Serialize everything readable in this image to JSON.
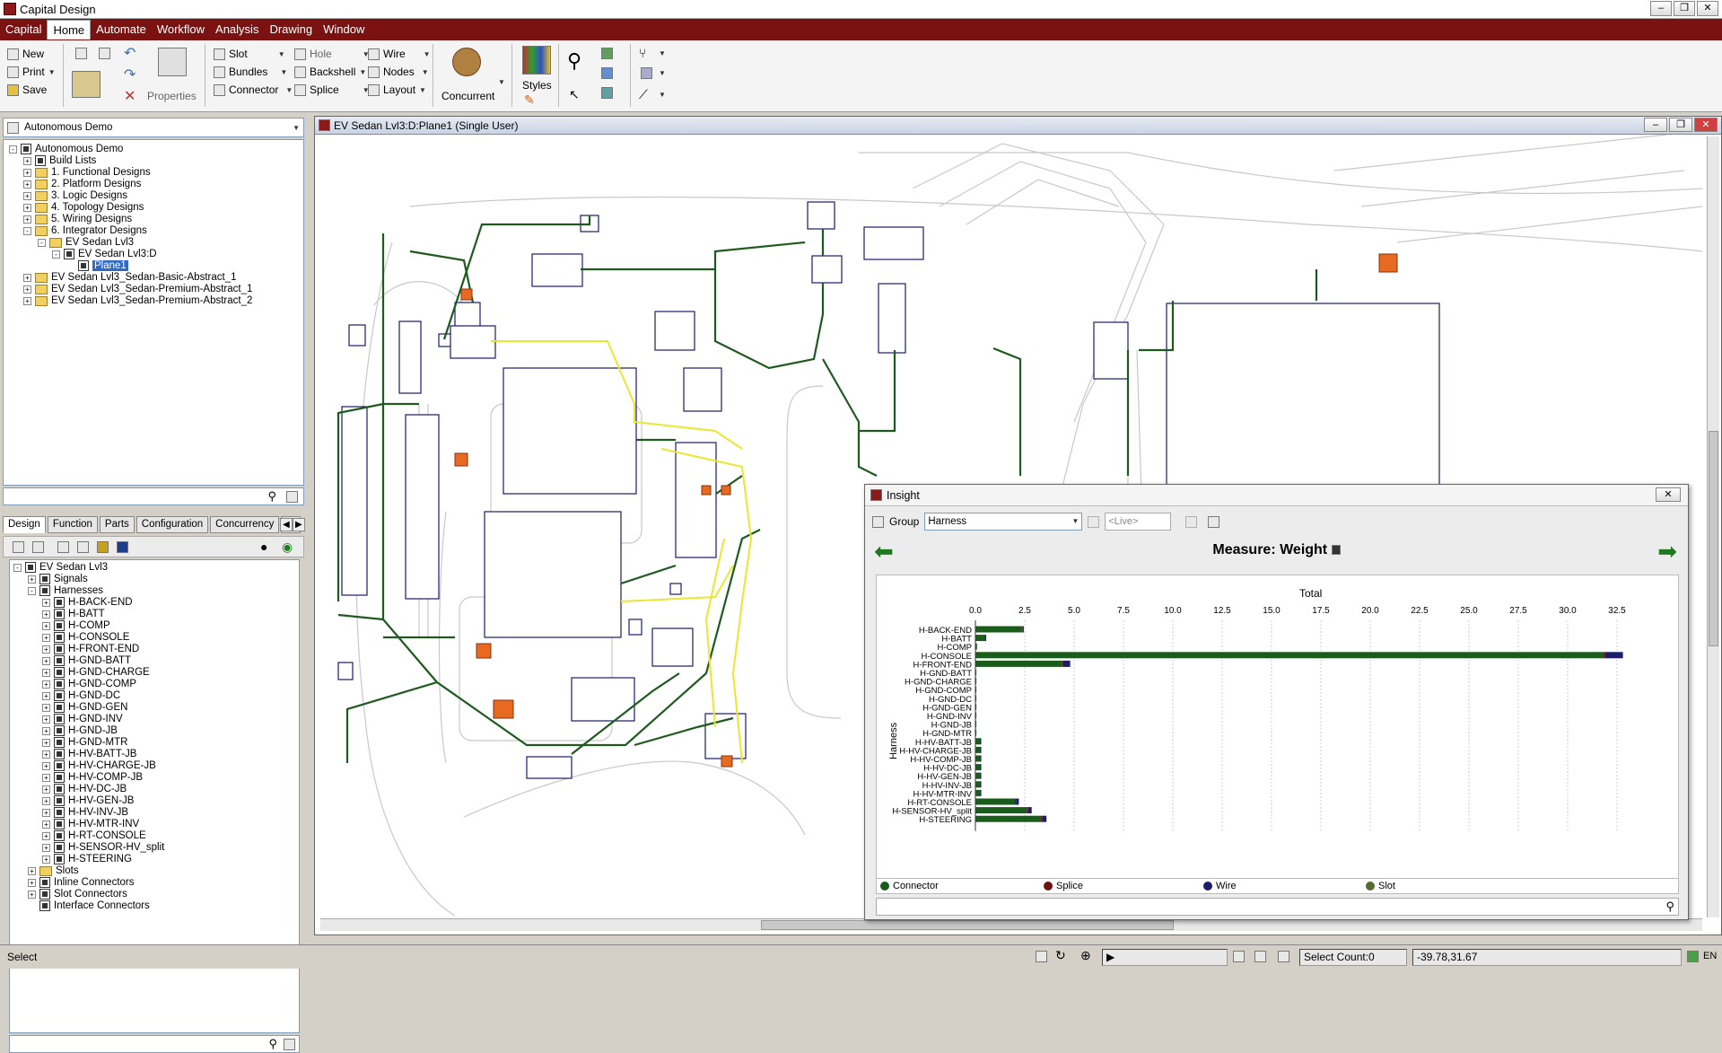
{
  "app": {
    "title": "Capital Design",
    "brand_color": "#7a1212"
  },
  "menu": [
    "Capital",
    "Home",
    "Automate",
    "Workflow",
    "Analysis",
    "Drawing",
    "Window"
  ],
  "ribbon": {
    "file": [
      "New",
      "Print",
      "Save"
    ],
    "properties": "Properties",
    "col1": [
      "Slot",
      "Bundles",
      "Connector"
    ],
    "col2": [
      "Hole",
      "Backshell",
      "Splice"
    ],
    "col3": [
      "Wire",
      "Nodes",
      "Layout"
    ],
    "concurrent": "Concurrent",
    "styles": "Styles"
  },
  "project": {
    "selector": "Autonomous Demo",
    "tree": [
      {
        "label": "Autonomous Demo",
        "level": 0,
        "exp": "-",
        "icon": "project"
      },
      {
        "label": "Build Lists",
        "level": 1,
        "exp": "+",
        "icon": "list"
      },
      {
        "label": "1. Functional Designs",
        "level": 1,
        "exp": "+",
        "icon": "folder"
      },
      {
        "label": "2. Platform Designs",
        "level": 1,
        "exp": "+",
        "icon": "folder"
      },
      {
        "label": "3. Logic Designs",
        "level": 1,
        "exp": "+",
        "icon": "folder"
      },
      {
        "label": "4. Topology Designs",
        "level": 1,
        "exp": "+",
        "icon": "folder"
      },
      {
        "label": "5. Wiring Designs",
        "level": 1,
        "exp": "+",
        "icon": "folder"
      },
      {
        "label": "6. Integrator Designs",
        "level": 1,
        "exp": "-",
        "icon": "folder"
      },
      {
        "label": "EV Sedan Lvl3",
        "level": 2,
        "exp": "-",
        "icon": "folder"
      },
      {
        "label": "EV Sedan Lvl3:D",
        "level": 3,
        "exp": "-",
        "icon": "design"
      },
      {
        "label": "Plane1",
        "level": 4,
        "exp": "",
        "icon": "design",
        "selected": true
      },
      {
        "label": "EV Sedan Lvl3_Sedan-Basic-Abstract_1",
        "level": 1,
        "exp": "+",
        "icon": "folder"
      },
      {
        "label": "EV Sedan Lvl3_Sedan-Premium-Abstract_1",
        "level": 1,
        "exp": "+",
        "icon": "folder"
      },
      {
        "label": "EV Sedan Lvl3_Sedan-Premium-Abstract_2",
        "level": 1,
        "exp": "+",
        "icon": "folder"
      }
    ]
  },
  "design_tabs": [
    "Design",
    "Function",
    "Parts",
    "Configuration",
    "Concurrency",
    "..."
  ],
  "design_tree": {
    "root": "EV Sedan Lvl3",
    "signals": "Signals",
    "harnesses": "Harnesses",
    "harness_items": [
      "H-BACK-END",
      "H-BATT",
      "H-COMP",
      "H-CONSOLE",
      "H-FRONT-END",
      "H-GND-BATT",
      "H-GND-CHARGE",
      "H-GND-COMP",
      "H-GND-DC",
      "H-GND-GEN",
      "H-GND-INV",
      "H-GND-JB",
      "H-GND-MTR",
      "H-HV-BATT-JB",
      "H-HV-CHARGE-JB",
      "H-HV-COMP-JB",
      "H-HV-DC-JB",
      "H-HV-GEN-JB",
      "H-HV-INV-JB",
      "H-HV-MTR-INV",
      "H-RT-CONSOLE",
      "H-SENSOR-HV_split",
      "H-STEERING"
    ],
    "others": [
      "Slots",
      "Inline Connectors",
      "Slot Connectors",
      "Interface Connectors"
    ]
  },
  "canvas": {
    "title": "EV Sedan Lvl3:D:Plane1 (Single User)"
  },
  "insight": {
    "title": "Insight",
    "group_label": "Group",
    "group_value": "Harness",
    "live_placeholder": "<Live>",
    "measure": "Measure: Weight",
    "column_title": "Total",
    "y_label": "Harness",
    "legend": [
      {
        "label": "Connector",
        "color": "#1a5c1a"
      },
      {
        "label": "Splice",
        "color": "#6b1414"
      },
      {
        "label": "Wire",
        "color": "#1c1c6a"
      },
      {
        "label": "Slot",
        "color": "#556b2f"
      }
    ]
  },
  "chart_data": {
    "type": "bar",
    "orientation": "horizontal",
    "title": "Total",
    "ylabel": "Harness",
    "xlim": [
      0,
      35
    ],
    "xticks": [
      "0.0",
      "2.5",
      "5.0",
      "7.5",
      "10.0",
      "12.5",
      "15.0",
      "17.5",
      "20.0",
      "22.5",
      "25.0",
      "27.5",
      "30.0",
      "32.5"
    ],
    "categories": [
      "H-BACK-END",
      "H-BATT",
      "H-COMP",
      "H-CONSOLE",
      "H-FRONT-END",
      "H-GND-BATT",
      "H-GND-CHARGE",
      "H-GND-COMP",
      "H-GND-DC",
      "H-GND-GEN",
      "H-GND-INV",
      "H-GND-JB",
      "H-GND-MTR",
      "H-HV-BATT-JB",
      "H-HV-CHARGE-JB",
      "H-HV-COMP-JB",
      "H-HV-DC-JB",
      "H-HV-GEN-JB",
      "H-HV-INV-JB",
      "H-HV-MTR-INV",
      "H-RT-CONSOLE",
      "H-SENSOR-HV_split",
      "H-STEERING"
    ],
    "series": [
      {
        "name": "Connector",
        "color": "#1a5c1a",
        "values": [
          2.35,
          0.5,
          0.08,
          31.8,
          4.4,
          0.05,
          0.05,
          0.05,
          0.05,
          0.05,
          0.05,
          0.05,
          0.05,
          0.25,
          0.25,
          0.25,
          0.25,
          0.25,
          0.25,
          0.25,
          2.0,
          2.6,
          3.3
        ]
      },
      {
        "name": "Splice",
        "color": "#6b1414",
        "values": [
          0.05,
          0,
          0,
          0.1,
          0.1,
          0,
          0,
          0,
          0,
          0,
          0,
          0,
          0,
          0,
          0,
          0,
          0,
          0,
          0,
          0,
          0.05,
          0.05,
          0.1
        ]
      },
      {
        "name": "Wire",
        "color": "#1c1c6a",
        "values": [
          0.05,
          0.02,
          0,
          0.9,
          0.3,
          0,
          0,
          0,
          0,
          0,
          0,
          0,
          0,
          0.02,
          0.02,
          0.02,
          0.02,
          0.02,
          0.02,
          0.02,
          0.15,
          0.2,
          0.2
        ]
      },
      {
        "name": "Slot",
        "color": "#556b2f",
        "values": [
          0,
          0,
          0,
          0,
          0,
          0,
          0,
          0,
          0,
          0,
          0,
          0,
          0,
          0,
          0,
          0,
          0,
          0,
          0,
          0,
          0,
          0,
          0
        ]
      }
    ]
  },
  "status": {
    "mode": "Select",
    "select_count": "Select Count:0",
    "coords": "-39.78,31.67",
    "lang": "EN"
  }
}
